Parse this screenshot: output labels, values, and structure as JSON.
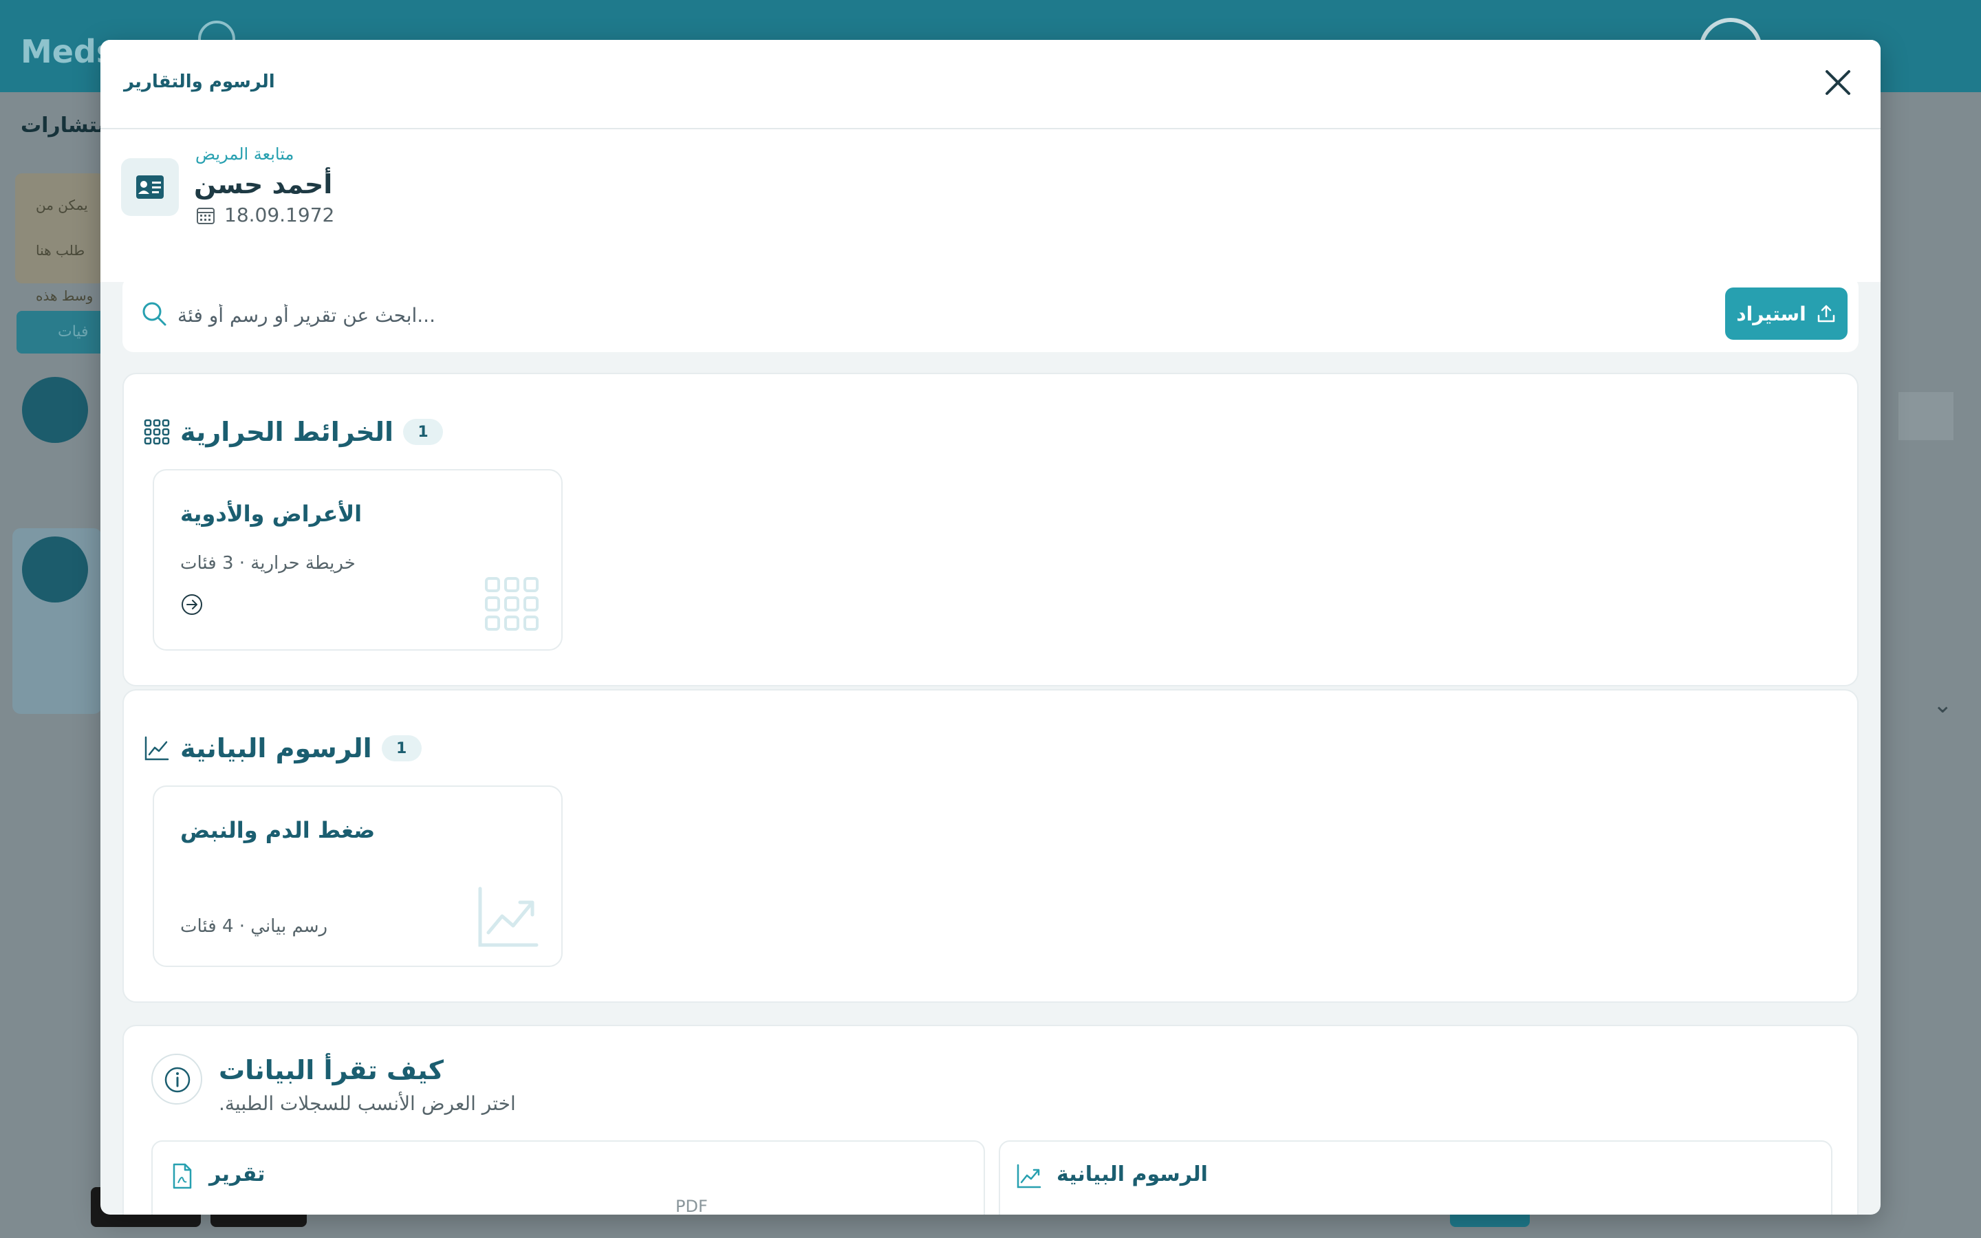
{
  "background": {
    "app_name": "Meds",
    "nav_label": "استشارات",
    "note_lines": [
      "يمكن من",
      "طلب هنا",
      "وسط هذه"
    ],
    "tab_label": "فيات"
  },
  "modal": {
    "title": "الرسوم والتقارير",
    "patient": {
      "label": "متابعة المريض",
      "name": "أحمد حسن",
      "dob": "18.09.1972"
    },
    "search": {
      "placeholder": "...ابحث عن تقرير أو رسم أو فئة",
      "import_label": "استيراد"
    },
    "sections": [
      {
        "title": "الخرائط الحرارية",
        "count": "1",
        "icon": "grid-icon",
        "cards": [
          {
            "title": "الأعراض والأدوية",
            "meta": "خريطة حرارية · 3 فئات",
            "icon": "grid-icon"
          }
        ]
      },
      {
        "title": "الرسوم البيانية",
        "count": "1",
        "icon": "line-chart-icon",
        "cards": [
          {
            "title": "ضغط الدم والنبض",
            "meta": "رسم بياني · 4 فئات",
            "icon": "line-chart-icon"
          }
        ]
      }
    ],
    "info": {
      "title": "كيف تقرأ البيانات",
      "subtitle": ".اختر العرض الأنسب للسجلات الطبية",
      "options": [
        {
          "title": "تقرير",
          "desc": "PDF",
          "icon": "pdf-file-icon"
        },
        {
          "title": "الرسوم البيانية",
          "desc": "",
          "icon": "line-chart-icon"
        }
      ]
    }
  },
  "colors": {
    "primary": "#1b5e70",
    "accent": "#27a0b0",
    "header_bg": "#1f7a8c",
    "muted_text": "#56646a"
  }
}
